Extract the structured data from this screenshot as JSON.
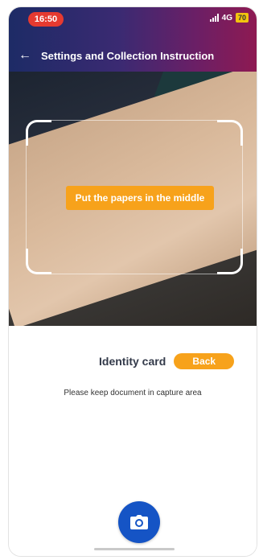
{
  "status_bar": {
    "time": "16:50",
    "network": "4G",
    "battery": "70"
  },
  "header": {
    "back_icon": "back-arrow-icon",
    "title": "Settings and Collection Instruction"
  },
  "camera": {
    "hint": "Put the papers in the middle"
  },
  "panel": {
    "document_label": "Identity card",
    "side_button": "Back",
    "instruction": "Please keep document in capture area",
    "shutter_icon": "camera-icon"
  },
  "colors": {
    "accent": "#f7a21b",
    "shutter": "#1554c5",
    "time_pill": "#e63a30"
  }
}
